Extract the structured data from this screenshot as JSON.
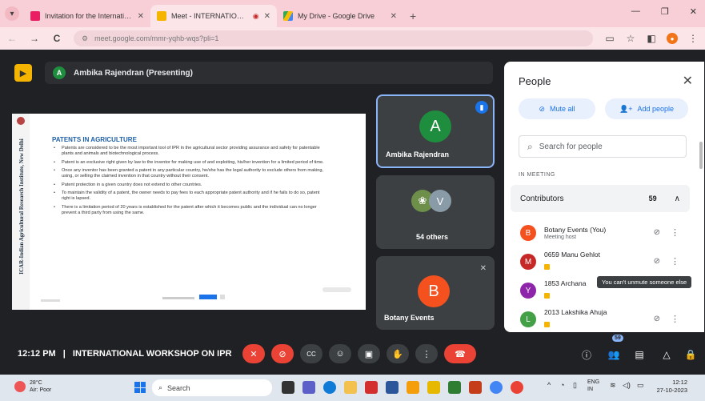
{
  "browser": {
    "tabs": [
      {
        "title": "Invitation for the Internationa",
        "favicon_color": "#e91e63",
        "active": false
      },
      {
        "title": "Meet - INTERNATIONAL V",
        "favicon_color": "#f4b400",
        "active": true
      },
      {
        "title": "My Drive - Google Drive",
        "favicon_color": "#34a853",
        "active": false
      }
    ],
    "new_tab": "+",
    "url": "meet.google.com/mmr-yqhb-wqs?pli=1",
    "window_controls": [
      "—",
      "❐",
      "✕"
    ]
  },
  "meet": {
    "presenter_initial": "A",
    "presenter_label": "Ambika Rajendran (Presenting)",
    "slide": {
      "side_text": "ICAR-Indian Agricultural Research Institute, New Delhi",
      "title": "PATENTS IN AGRICULTURE",
      "bullets": [
        "Patents are considered to be the most important tool of IPR in the agricultural sector providing assurance and safety for patentable plants and animals and biotechnological process.",
        "Patent is an exclusive right given by law to the inventor for making use of and exploiting, his/her invention for a limited period of time.",
        "Once any inventor has been granted a patent in any particular country, he/she has the legal authority to exclude others from making, using, or selling the claimed invention in that country without their consent.",
        "Patent protection in a given country does not extend to other countries.",
        "To maintain the validity of a patent, the owner needs to pay fees to each appropriate patent authority and if he fails to do so, patent right is lapsed.",
        "There is a limitation period of 20 years is established for the patent after which it becomes public and the individual can no longer prevent a third party from using the same."
      ]
    },
    "tiles": [
      {
        "name": "Ambika Rajendran",
        "initial": "A",
        "color": "#1e8e3e"
      },
      {
        "name": "54 others",
        "initial": "V",
        "color": "#8a9ba8"
      },
      {
        "name": "Botany Events",
        "initial": "B",
        "color": "#f4511e"
      }
    ],
    "time": "12:12 PM",
    "separator": "|",
    "meeting_title": "INTERNATIONAL WORKSHOP ON IPR",
    "people_badge": "59"
  },
  "panel": {
    "title": "People",
    "mute_all": "Mute all",
    "add_people": "Add people",
    "search_placeholder": "Search for people",
    "section": "IN MEETING",
    "contributors_label": "Contributors",
    "contributors_count": "59",
    "people": [
      {
        "name": "Botany Events (You)",
        "sub": "Meeting host",
        "initial": "B",
        "color": "#f4511e"
      },
      {
        "name": "0659 Manu Gehlot",
        "sub": "",
        "initial": "M",
        "color": "#c62828"
      },
      {
        "name": "1853 Archana",
        "sub": "",
        "initial": "Y",
        "color": "#8e24aa"
      },
      {
        "name": "2013 Lakshika Ahuja",
        "sub": "",
        "initial": "L",
        "color": "#43a047"
      }
    ],
    "tooltip": "You can't unmute someone else"
  },
  "taskbar": {
    "weather_temp": "28°C",
    "weather_desc": "Air: Poor",
    "search_label": "Search",
    "lang_top": "ENG",
    "lang_bottom": "IN",
    "time": "12:12",
    "date": "27-10-2023"
  },
  "icons": {
    "chevron_down": "▾",
    "close": "✕",
    "back": "←",
    "forward": "→",
    "reload": "C",
    "site_settings": "⚙",
    "star": "☆",
    "search": "⌕",
    "mic_off": "🎤",
    "cam_off": "⊘",
    "captions": "CC",
    "emoji": "☺",
    "present": "▣",
    "hand": "✋",
    "more": "⋮",
    "hangup": "☎",
    "info": "ⓘ",
    "people": "👥",
    "chat": "▤",
    "activities": "△",
    "lock": "🔒",
    "add_person": "+",
    "expand_less": "∧",
    "media_sidebar": "◧"
  }
}
